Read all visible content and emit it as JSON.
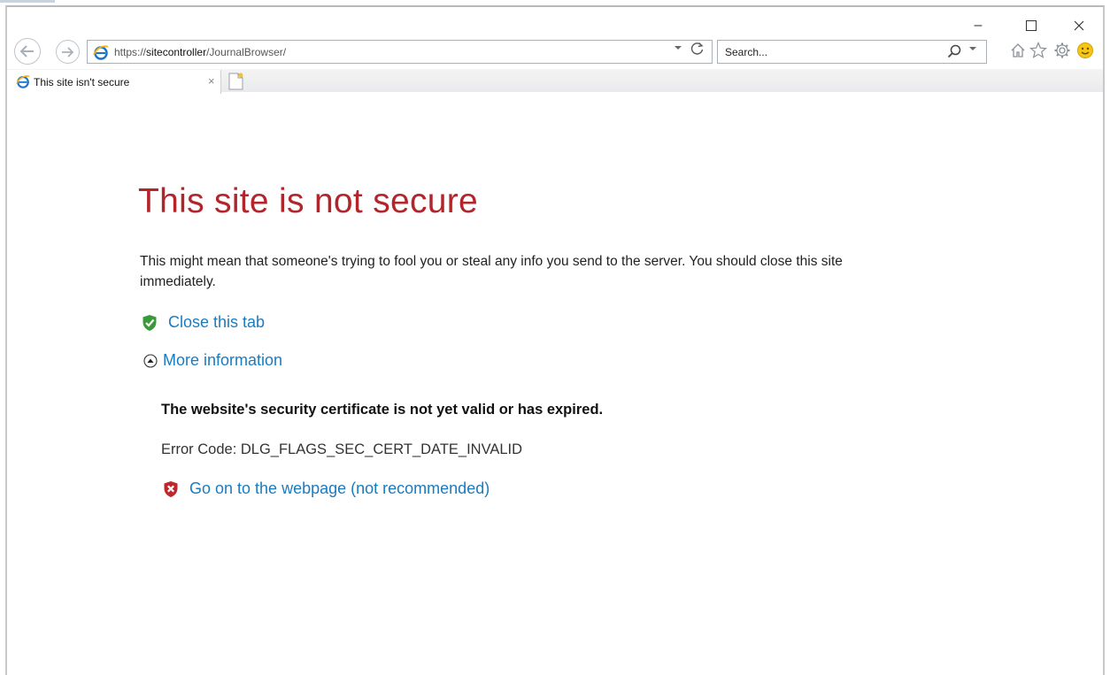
{
  "window": {
    "minimize_glyph": "–",
    "maximize_glyph": "☐",
    "close_glyph": "✕"
  },
  "toolbar": {
    "address_scheme": "https://",
    "address_host": "sitecontroller",
    "address_path": "/JournalBrowser/",
    "search_placeholder": "Search..."
  },
  "tabs": [
    {
      "label": "This site isn't secure",
      "close_glyph": "×"
    }
  ],
  "page": {
    "title": "This site is not secure",
    "description": "This might mean that someone's trying to fool you or steal any info you send to the server. You should close this site immediately.",
    "close_tab_label": "Close this tab",
    "more_info_label": "More information",
    "cert_message": "The website's security certificate is not yet valid or has expired.",
    "error_code": "Error Code: DLG_FLAGS_SEC_CERT_DATE_INVALID",
    "go_on_label": "Go on to the webpage (not recommended)"
  },
  "colors": {
    "title_red": "#b1252b",
    "link_blue": "#1a7bbf",
    "shield_green": "#3a9a3a",
    "shield_red": "#c0272d"
  },
  "icons": [
    "back-arrow-icon",
    "forward-arrow-icon",
    "ie-logo-icon",
    "refresh-icon",
    "search-icon",
    "home-icon",
    "star-icon",
    "gear-icon",
    "smiley-icon",
    "new-tab-icon",
    "green-shield-check-icon",
    "circle-up-arrow-icon",
    "red-shield-x-icon"
  ]
}
